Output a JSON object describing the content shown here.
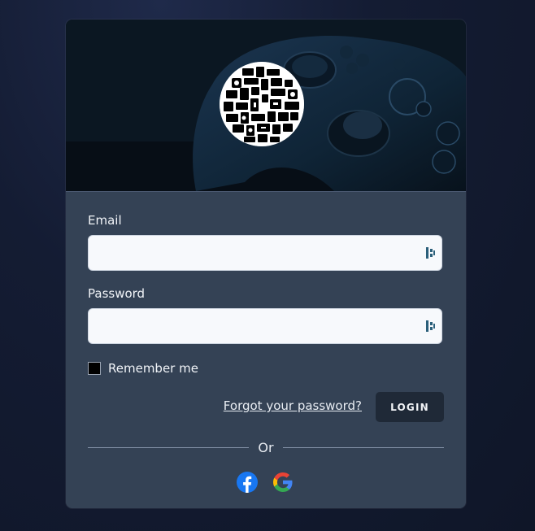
{
  "login": {
    "email_label": "Email",
    "email_value": "",
    "password_label": "Password",
    "password_value": "",
    "remember_label": "Remember me",
    "remember_checked": false,
    "forgot_label": "Forgot your password?",
    "login_label": "LOGIN",
    "divider_label": "Or"
  },
  "social": {
    "facebook_icon": "facebook-icon",
    "google_icon": "google-icon"
  },
  "banner": {
    "background_icon": "gamepad-icon",
    "logo_icon": "retro-consoles-logo"
  },
  "colors": {
    "page_bg": "#141c33",
    "card_bg": "#344255",
    "input_bg": "#f7f9fc",
    "button_bg": "#1f2937",
    "text": "#f1f4f8",
    "divider": "#8391a6",
    "facebook": "#1877f2"
  }
}
